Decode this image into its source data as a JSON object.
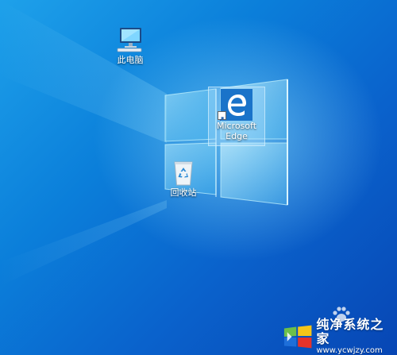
{
  "desktop": {
    "icons": [
      {
        "label": "此电脑",
        "icon": "computer-icon",
        "selected": false
      },
      {
        "label": "Microsoft Edge",
        "icon": "edge-icon",
        "selected": true
      },
      {
        "label": "回收站",
        "icon": "recycle-bin-icon",
        "selected": false
      }
    ]
  },
  "watermark": {
    "title": "纯净系统之家",
    "url": "www.ycwjzy.com",
    "colors": {
      "green": "#6cc04a",
      "yellow": "#f5c518",
      "blue": "#1e6fd9",
      "red": "#e5332a"
    }
  },
  "colors": {
    "edge_blue": "#1a73c9",
    "accent_light": "#9fe8ff"
  }
}
